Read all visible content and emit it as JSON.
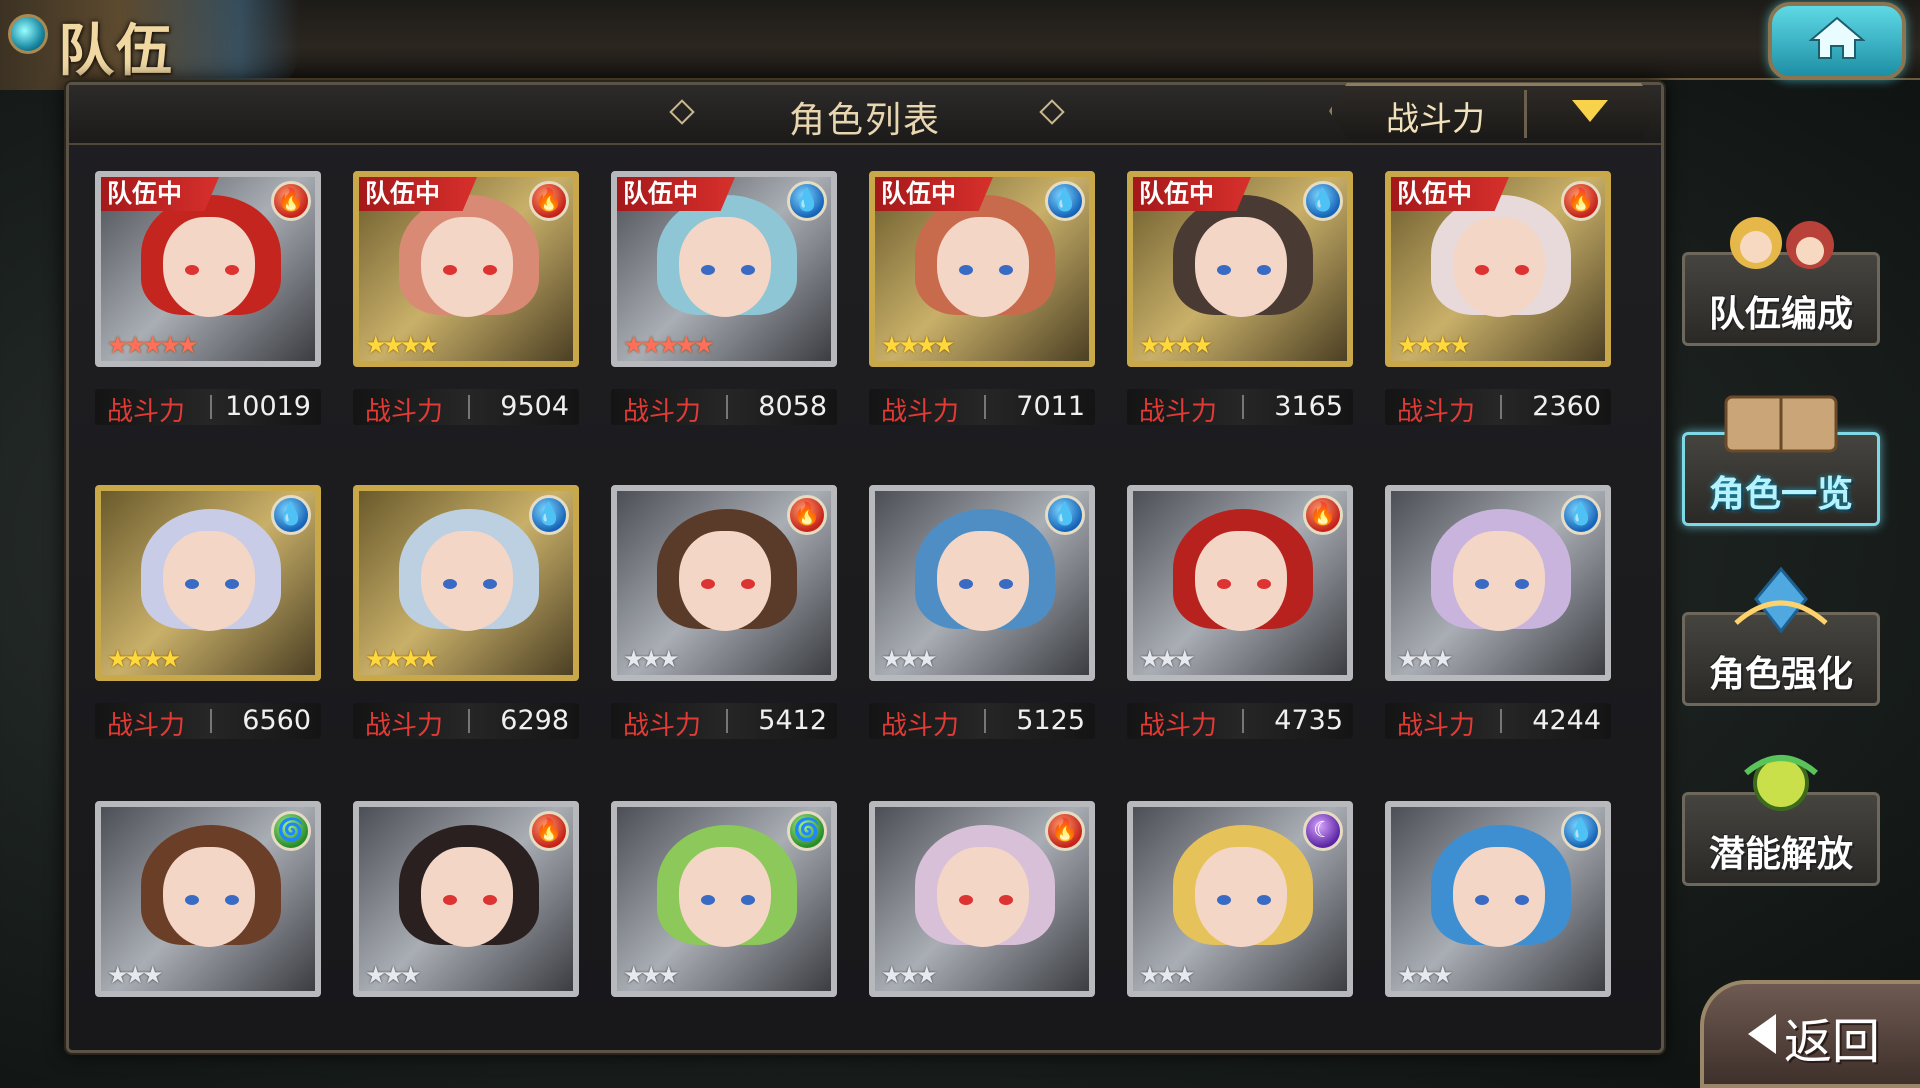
{
  "header": {
    "title": "队伍"
  },
  "panel": {
    "list_title": "角色列表",
    "sort_label": "战斗力"
  },
  "power_label": "战斗力",
  "party_tag": "队伍中",
  "characters": [
    {
      "element": "fire",
      "stars": 5,
      "frame": "silver",
      "in_party": true,
      "power": "10019",
      "hair": "#c4261f"
    },
    {
      "element": "fire",
      "stars": 4,
      "frame": "gold",
      "in_party": true,
      "power": "9504",
      "hair": "#d98a74"
    },
    {
      "element": "water",
      "stars": 5,
      "frame": "silver",
      "in_party": true,
      "power": "8058",
      "hair": "#8fc6d6"
    },
    {
      "element": "water",
      "stars": 4,
      "frame": "gold",
      "in_party": true,
      "power": "7011",
      "hair": "#c86a4c"
    },
    {
      "element": "water",
      "stars": 4,
      "frame": "gold",
      "in_party": true,
      "power": "3165",
      "hair": "#4a3a34"
    },
    {
      "element": "fire",
      "stars": 4,
      "frame": "gold",
      "in_party": true,
      "power": "2360",
      "hair": "#e8dada"
    },
    {
      "element": "water",
      "stars": 4,
      "frame": "gold",
      "in_party": false,
      "power": "6560",
      "hair": "#c9cce6"
    },
    {
      "element": "water",
      "stars": 4,
      "frame": "gold",
      "in_party": false,
      "power": "6298",
      "hair": "#bcd0e2"
    },
    {
      "element": "fire",
      "stars": 3,
      "frame": "silver",
      "in_party": false,
      "power": "5412",
      "hair": "#5a3a28"
    },
    {
      "element": "water",
      "stars": 3,
      "frame": "silver",
      "in_party": false,
      "power": "5125",
      "hair": "#4f8ec4"
    },
    {
      "element": "fire",
      "stars": 3,
      "frame": "silver",
      "in_party": false,
      "power": "4735",
      "hair": "#b7221e"
    },
    {
      "element": "water",
      "stars": 3,
      "frame": "silver",
      "in_party": false,
      "power": "4244",
      "hair": "#c8b4dc"
    },
    {
      "element": "wind",
      "stars": 3,
      "frame": "silver",
      "in_party": false,
      "power": "",
      "hair": "#6b3e28"
    },
    {
      "element": "fire",
      "stars": 3,
      "frame": "silver",
      "in_party": false,
      "power": "",
      "hair": "#2a2020"
    },
    {
      "element": "wind",
      "stars": 3,
      "frame": "silver",
      "in_party": false,
      "power": "",
      "hair": "#8cc85a"
    },
    {
      "element": "fire",
      "stars": 3,
      "frame": "silver",
      "in_party": false,
      "power": "",
      "hair": "#d8c0d8"
    },
    {
      "element": "dark",
      "stars": 3,
      "frame": "silver",
      "in_party": false,
      "power": "",
      "hair": "#e6c25a"
    },
    {
      "element": "water",
      "stars": 3,
      "frame": "silver",
      "in_party": false,
      "power": "",
      "hair": "#3e8ed2"
    }
  ],
  "side_menu": [
    {
      "label": "队伍编成",
      "icon": "party-members-icon",
      "active": false
    },
    {
      "label": "角色一览",
      "icon": "book-icon",
      "active": true
    },
    {
      "label": "角色强化",
      "icon": "upgrade-crystal-icon",
      "active": false
    },
    {
      "label": "潜能解放",
      "icon": "potential-orb-icon",
      "active": false
    }
  ],
  "back_label": "返回",
  "colors": {
    "accent": "#7fd8e6",
    "power_label": "#e33a35",
    "party_tag": "#c8201e"
  }
}
